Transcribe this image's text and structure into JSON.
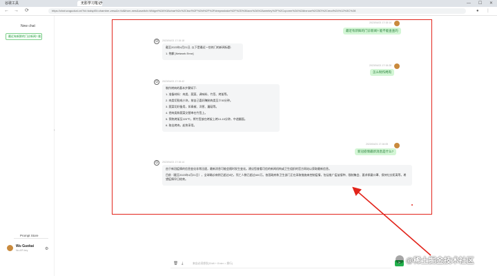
{
  "browser": {
    "tabs": [
      {
        "label": "谷歌工具"
      },
      {
        "label": "无影学习笔记"
      }
    ],
    "new_tab": "+",
    "window_controls": {
      "minimize": "—",
      "maximize": "☐",
      "close": "✕"
    },
    "nav": {
      "back": "←",
      "forward": "→",
      "reload": "⟳"
    },
    "url": "https://chat.wuguokai.cn/?id=todspi5l=chamber-zesu&r=ful&from-new&uswitch=Widget%2A%3Avinar%2c%2Cburl%2F%2fd%2F%2Fdeepwshake%2F%2D%36avo%2A%2Aweeley%2F%2Ccpomn%2A%2Abxnow%2CBO%2Crecd%24%12%3C%28"
  },
  "sidebar": {
    "new_chat": "New chat",
    "chat_item": "最近有新鲜的门诊新闻? 能不能...",
    "prompt_store": "Prompt Store",
    "user_name": "Wu Guokai",
    "user_status": "No API key",
    "settings_icon": "gear-icon"
  },
  "messages": [
    {
      "role": "user",
      "time": "2023/04/21 17:15:14",
      "text": "最近有新鲜的门诊新闻? 能不能查查的"
    },
    {
      "role": "assistant",
      "time": "2023/04/21 17:15:18",
      "lines": [
        "截至2023年4月21日, 以下是最近一些热门的新闻标题:",
        "1. 抱歉 [Network Error]"
      ]
    },
    {
      "role": "user",
      "time": "2023/04/21 17:15:28",
      "text": "怎么制作烤肉"
    },
    {
      "role": "assistant",
      "time": "2023/04/21 17:15:42",
      "lines": [
        "制作烤肉的基本步骤如下:",
        "1. 准备材料：肉类、蔬菜、调味料、竹签、烤架等。",
        "2. 肉类切割成小块，按自己喜好腌制肉类至少30分钟。",
        "3. 蔬菜切好备用，如青椒、洋葱、蘑菇等。",
        "4. 把肉类和蔬菜交替串在竹签上。",
        "5. 预热烤架至220℃，将竹签放在烤架上烤10-15分钟，中途翻面。",
        "6. 取出烤肉，趁热享用。"
      ]
    },
    {
      "role": "user",
      "time": "2023/04/21 17:16:05",
      "text": "新冠疫情最新消息是什么?"
    },
    {
      "role": "assistant",
      "time": "2023/04/21 17:16:14",
      "lines": [
        "由于新冠疫情的信息变化非常迅速，最新消息可能会随时发生变化。建议您查看可信的新闻机构或卫生组织的官方网站以获取最新信息。",
        "目前（截至2023年4月21日），全球确诊病例已超过6亿，死亡人数已超过600万。各国政府和卫生部门正在采取措施来控制疫情，包括推广疫苗接种、限制集会、要求佩戴口罩、保持社交距离等，希望疫情早日结束。"
      ]
    }
  ],
  "input": {
    "placeholder": "来自必须想发(Shift + Enter = 换行)",
    "send_label": "➤",
    "icons": {
      "delete": "🗑",
      "download": "⤓",
      "history": "⟲"
    }
  },
  "watermark": "@稀土掘金技术社区",
  "colors": {
    "annotation_red": "#e2231a",
    "accent_green": "#22b14c",
    "user_bubble": "#d3f6d5"
  }
}
